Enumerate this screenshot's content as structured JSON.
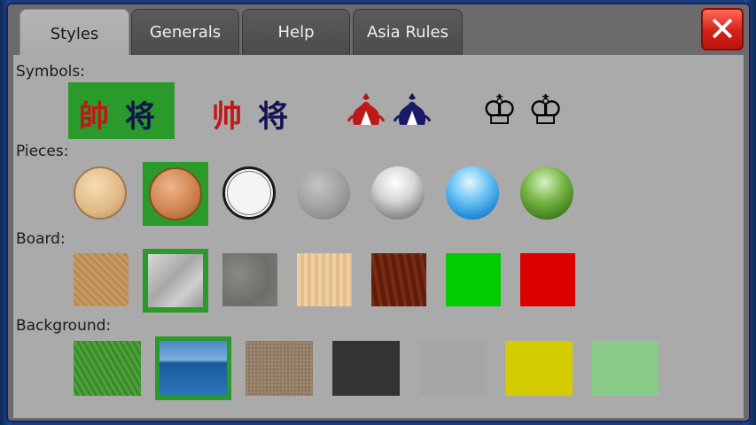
{
  "tabs": [
    {
      "label": "Styles",
      "active": true
    },
    {
      "label": "Generals",
      "active": false
    },
    {
      "label": "Help",
      "active": false
    },
    {
      "label": "Asia Rules",
      "active": false
    }
  ],
  "close_icon": "close-x-icon",
  "sections": {
    "symbols": {
      "label": "Symbols:"
    },
    "pieces": {
      "label": "Pieces:"
    },
    "board": {
      "label": "Board:"
    },
    "background": {
      "label": "Background:"
    }
  },
  "symbols": [
    {
      "red": "帥",
      "black": "将",
      "selected": true
    },
    {
      "red": "帅",
      "black": "将",
      "selected": false
    },
    {
      "red_icon": "red-elephant-emblem-icon",
      "black_icon": "blue-elephant-emblem-icon",
      "selected": false
    },
    {
      "red_icon": "white-king-chess-icon",
      "black_icon": "white-king-chess-icon",
      "selected": false
    }
  ],
  "pieces": [
    {
      "name": "light-wood-piece",
      "selected": false
    },
    {
      "name": "dark-wood-piece",
      "selected": true
    },
    {
      "name": "white-piece",
      "selected": false
    },
    {
      "name": "stone-piece",
      "selected": false
    },
    {
      "name": "silver-piece",
      "selected": false
    },
    {
      "name": "blue-glass-piece",
      "selected": false
    },
    {
      "name": "green-glass-piece",
      "selected": false
    }
  ],
  "boards": [
    {
      "name": "sand-wood-board",
      "selected": false
    },
    {
      "name": "brushed-metal-board",
      "selected": true
    },
    {
      "name": "granite-board",
      "selected": false
    },
    {
      "name": "light-wood-board",
      "selected": false
    },
    {
      "name": "mahogany-board",
      "selected": false
    },
    {
      "name": "green-board",
      "color": "#00cc00",
      "selected": false
    },
    {
      "name": "red-board",
      "color": "#dd0000",
      "selected": false
    }
  ],
  "backgrounds": [
    {
      "name": "grass-background",
      "selected": false
    },
    {
      "name": "ocean-background",
      "selected": true
    },
    {
      "name": "gravel-background",
      "selected": false
    },
    {
      "name": "dark-gray-background",
      "color": "#333333",
      "selected": false
    },
    {
      "name": "light-gray-background",
      "color": "#aaaaaa",
      "selected": false
    },
    {
      "name": "yellow-background",
      "color": "#d4cc00",
      "selected": false
    },
    {
      "name": "light-green-background",
      "color": "#88cc88",
      "selected": false
    }
  ],
  "colors": {
    "selection": "#2a9a2a",
    "panel": "#aaaaaa",
    "close": "#d2231a"
  }
}
